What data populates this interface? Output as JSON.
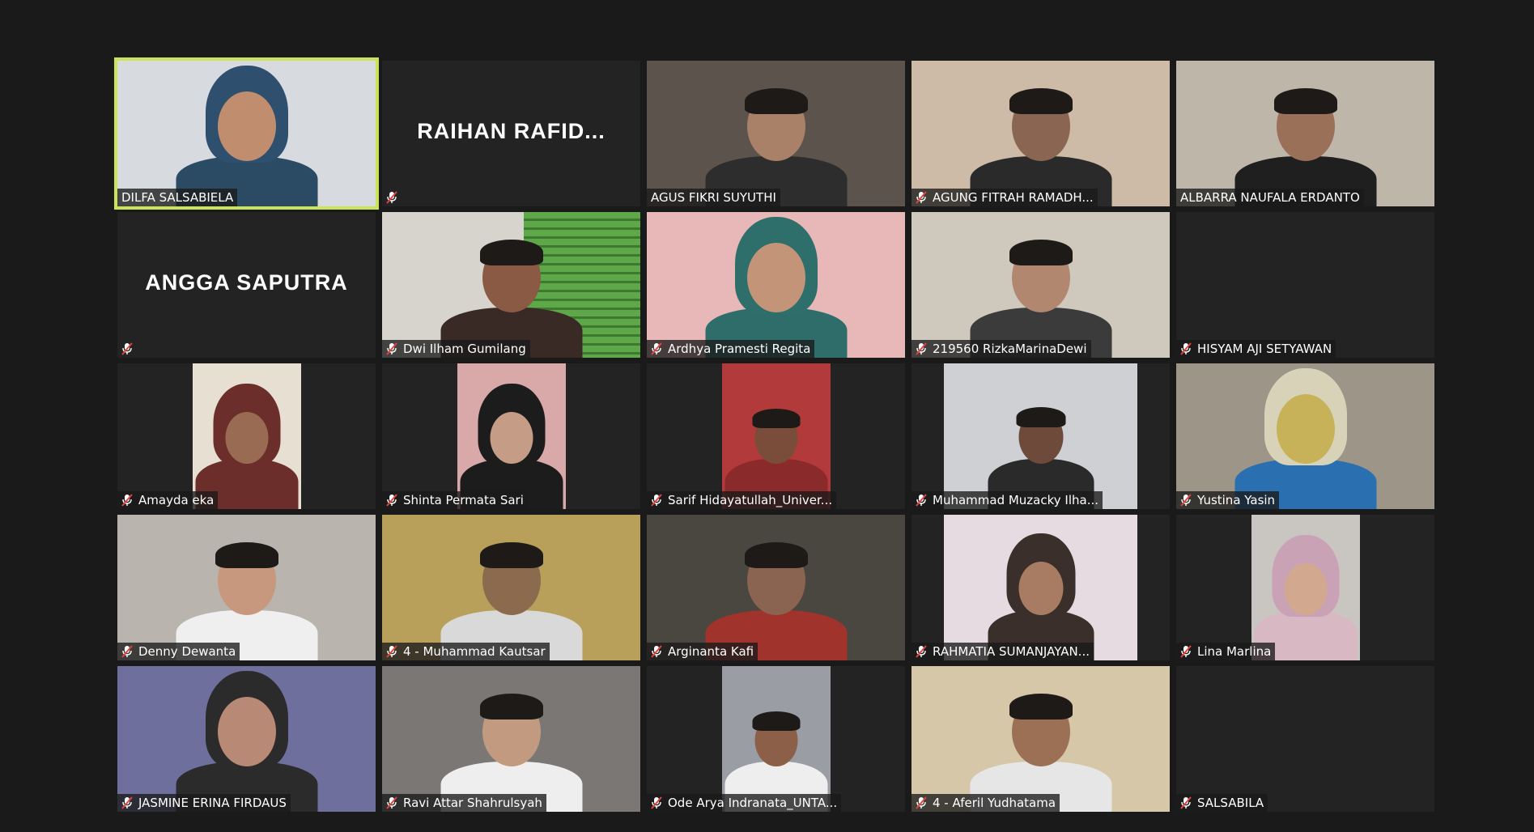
{
  "meeting": {
    "participants": [
      {
        "name": "DILFA SALSABIELA",
        "muted": false,
        "active_speaker": true,
        "video": "on",
        "bg": "#d7dbe0",
        "skin": "#c08d6e",
        "cloth": "#2b4a63",
        "hijab": "#2f4f6f"
      },
      {
        "name": "",
        "display_name": "RAIHAN  RAFID...",
        "muted": true,
        "video": "off"
      },
      {
        "name": "AGUS FIKRI SUYUTHI",
        "muted": false,
        "video": "on",
        "bg": "#5b534c",
        "skin": "#a98068",
        "cloth": "#2d2d2d"
      },
      {
        "name": "AGUNG FITRAH RAMADH...",
        "muted": true,
        "video": "on",
        "bg": "#cdbba8",
        "skin": "#8a6652",
        "cloth": "#2a2a2a"
      },
      {
        "name": "ALBARRA NAUFALA ERDANTO",
        "muted": false,
        "video": "on",
        "bg": "#bfb6aa",
        "skin": "#9b7058",
        "cloth": "#1f1f1f"
      },
      {
        "name": "",
        "display_name": "ANGGA SAPUTRA",
        "muted": true,
        "video": "off"
      },
      {
        "name": "Dwi Ilham Gumilang",
        "muted": true,
        "video": "on",
        "bg": "#d6d4cc",
        "accent": "#5fa84a",
        "skin": "#8a5a45",
        "cloth": "#3a2a25"
      },
      {
        "name": "Ardhya Pramesti Regita",
        "muted": true,
        "video": "on",
        "bg": "#e8b7b8",
        "skin": "#c49478",
        "cloth": "#2e6d6a",
        "hijab": "#2f6f6b"
      },
      {
        "name": "219560 RizkaMarinaDewi",
        "muted": true,
        "video": "on",
        "bg": "#cfc9bd",
        "skin": "#b28770",
        "cloth": "#3b3b3b"
      },
      {
        "name": "HISYAM AJI SETYAWAN",
        "muted": true,
        "video": "off_blank"
      },
      {
        "name": "Amayda eka",
        "muted": true,
        "video": "on_narrow",
        "bg": "#e6dfd2",
        "skin": "#9a6b53",
        "cloth": "#6b2e2a",
        "hijab": "#6b2e2a"
      },
      {
        "name": "Shinta Permata Sari",
        "muted": true,
        "video": "on_narrow",
        "bg": "#d9a8a8",
        "skin": "#c59d86",
        "cloth": "#1c1c1c",
        "hijab": "#1c1c1c"
      },
      {
        "name": "Sarif Hidayatullah_Univer...",
        "muted": true,
        "video": "on_narrow",
        "bg": "#b33a3a",
        "skin": "#7a4d3a",
        "cloth": "#8a2a2a"
      },
      {
        "name": "Muhammad Muzacky Ilha...",
        "muted": true,
        "video": "on_mid",
        "bg": "#cfd0d4",
        "skin": "#6e4a3a",
        "cloth": "#2a2a2a"
      },
      {
        "name": "Yustina Yasin",
        "muted": true,
        "video": "on",
        "bg": "#9d9587",
        "skin": "#c7b25a",
        "cloth": "#2a6fb0",
        "hijab": "#d8d3b8"
      },
      {
        "name": "Denny Dewanta",
        "muted": true,
        "video": "on",
        "bg": "#b9b4ad",
        "skin": "#c8987e",
        "cloth": "#efefef"
      },
      {
        "name": "4 - Muhammad Kautsar",
        "muted": true,
        "video": "on",
        "bg": "#b8a05a",
        "skin": "#8c6a4d",
        "cloth": "#d9d9d9"
      },
      {
        "name": "Arginanta Kafi",
        "muted": true,
        "video": "on",
        "bg": "#4a4640",
        "skin": "#8a6450",
        "cloth": "#a0342c"
      },
      {
        "name": "RAHMATIA SUMANJAYAN...",
        "muted": true,
        "video": "on_mid",
        "bg": "#e6dbe0",
        "skin": "#a87c62",
        "cloth": "#3a2f2a",
        "hijab": "#3a2f2a"
      },
      {
        "name": "Lina Marlina",
        "muted": true,
        "video": "on_narrow",
        "bg": "#c9c6c1",
        "skin": "#d2a88f",
        "cloth": "#d8b8c2",
        "hijab": "#c9a3b5"
      },
      {
        "name": "JASMINE ERINA FIRDAUS",
        "muted": true,
        "video": "on",
        "bg": "#6e6f9d",
        "skin": "#b88a75",
        "cloth": "#2b2b2b",
        "hijab": "#2b2b2b"
      },
      {
        "name": "Ravi Attar Shahrulsyah",
        "muted": true,
        "video": "on",
        "bg": "#7a7775",
        "skin": "#c29a80",
        "cloth": "#eeeeee"
      },
      {
        "name": "Ode Arya Indranata_UNTA...",
        "muted": true,
        "video": "on_narrow",
        "bg": "#9a9ea4",
        "skin": "#8c6048",
        "cloth": "#eeeeee"
      },
      {
        "name": "4 - Aferil Yudhatama",
        "muted": true,
        "video": "on",
        "bg": "#d6c7a8",
        "skin": "#9c7054",
        "cloth": "#e6e6e6"
      },
      {
        "name": "SALSABILA",
        "muted": true,
        "video": "off_blank"
      }
    ]
  },
  "colors": {
    "window_bg": "#1a1a1a",
    "tile_bg": "#232323",
    "active_speaker_border": "#c9e35a",
    "muted_icon": "#e0443e"
  },
  "icons": {
    "muted": "microphone-muted-icon"
  }
}
